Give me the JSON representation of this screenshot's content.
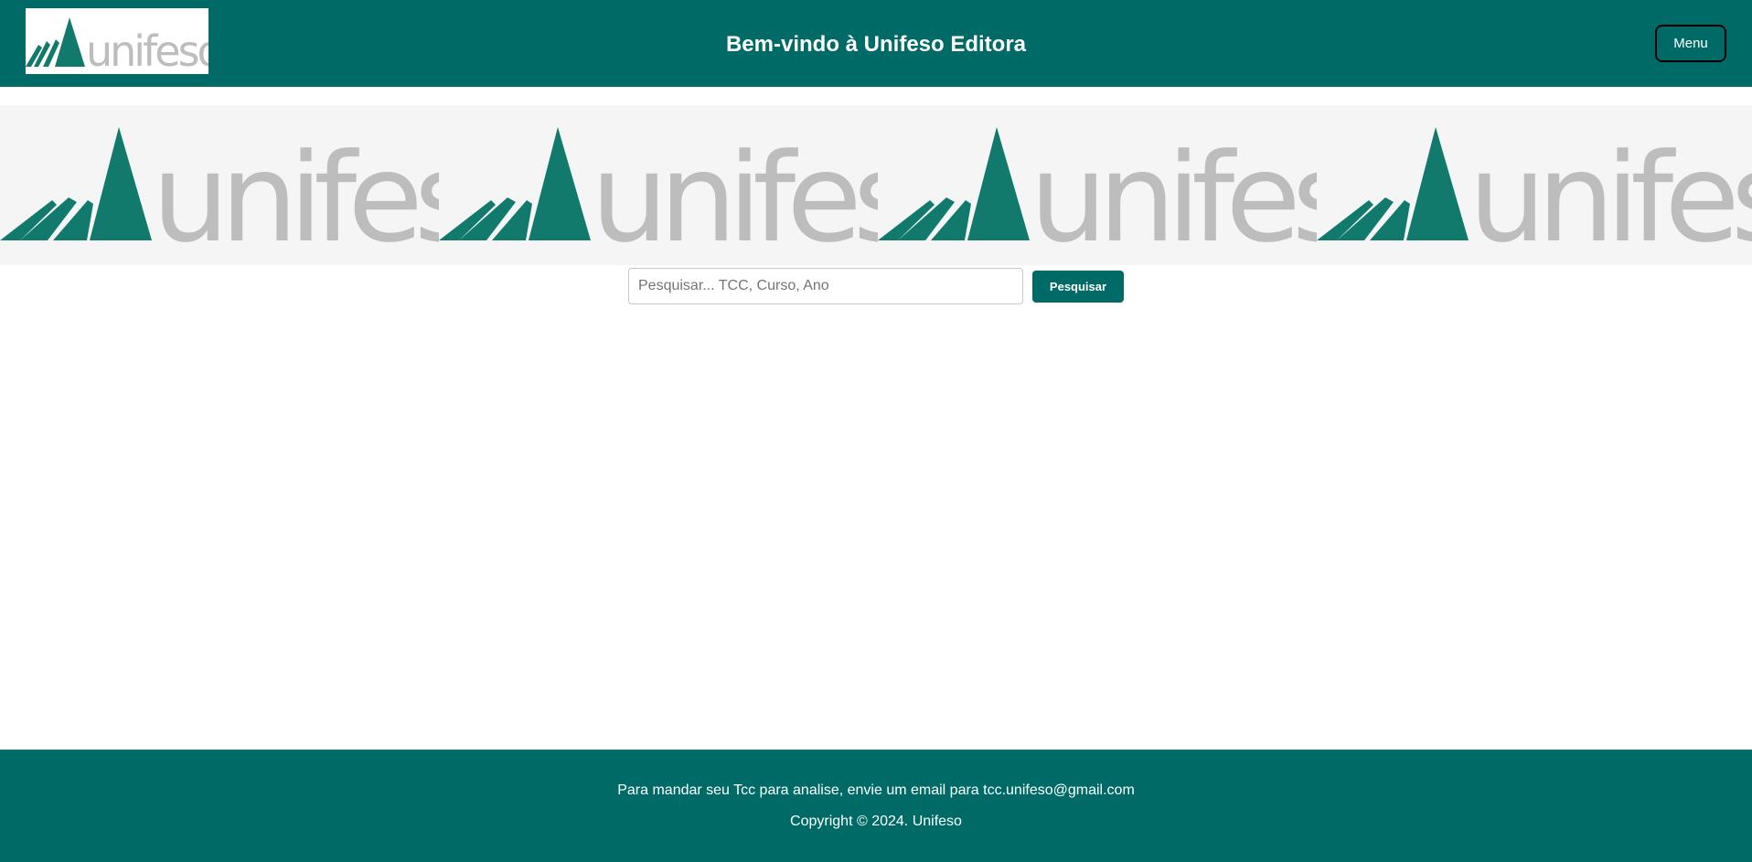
{
  "header": {
    "logo_text": "unifeso",
    "title": "Bem-vindo à Unifeso Editora",
    "menu_label": "Menu"
  },
  "banner": {
    "logo_text": "unifeso",
    "repeat_count": 4
  },
  "search": {
    "placeholder": "Pesquisar... TCC, Curso, Ano",
    "value": "",
    "button_label": "Pesquisar"
  },
  "footer": {
    "message": "Para mandar seu Tcc para analise, envie um email para tcc.unifeso@gmail.com",
    "copyright": "Copyright © 2024. Unifeso"
  },
  "colors": {
    "brand_teal": "#006b66",
    "logo_green": "#127a6c",
    "logo_gray": "#bdbdbd",
    "banner_bg": "#f5f5f5"
  }
}
